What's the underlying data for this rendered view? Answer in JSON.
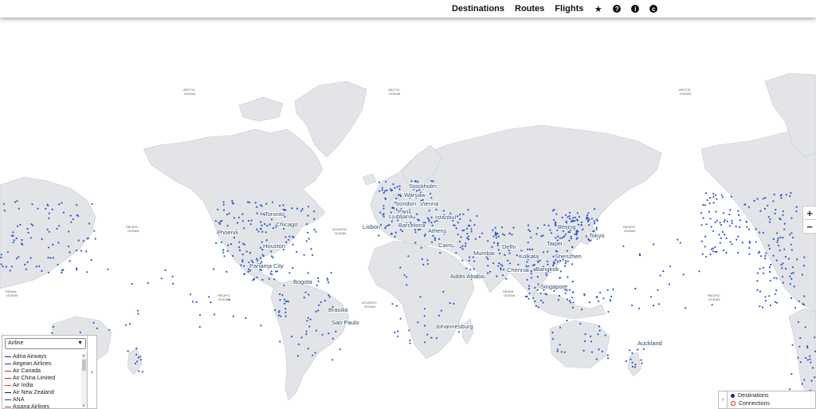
{
  "nav": {
    "links": [
      "Destinations",
      "Routes",
      "Flights"
    ],
    "icons": [
      "star-icon",
      "question-icon",
      "info-icon",
      "copyright-icon"
    ]
  },
  "map": {
    "ocean_labels": {
      "arctic": "ARCTIC\nOCEAN",
      "pacific": "PACIFIC\nOCEAN",
      "atlantic": "ATLANTIC\nOCEAN",
      "indian": "INDIAN\nOCEAN"
    },
    "cities": [
      "Toronto",
      "Chicago",
      "Phoenix",
      "Houston",
      "Panama City",
      "Bogota",
      "Brasilia",
      "Sao Paulo",
      "Lisbon",
      "Stockholm",
      "Warsaw",
      "London",
      "Paris",
      "Vienna",
      "Ljubljana",
      "Istanbul",
      "Barcelona",
      "Athens",
      "Cairo",
      "Addis Ababa",
      "Johannesburg",
      "Mumbai",
      "Delhi",
      "Kolkata",
      "Chennai",
      "Bangkok",
      "Singapore",
      "Beijing",
      "Taipei",
      "Shenzhen",
      "Tokyo",
      "Auckland"
    ],
    "zoom_in": "+",
    "zoom_out": "−"
  },
  "airline_panel": {
    "select_value": "Airline",
    "items": [
      {
        "name": "Adria Airways",
        "color": "#1e2f78"
      },
      {
        "name": "Aegean Airlines",
        "color": "#1e3f9a"
      },
      {
        "name": "Air Canada",
        "color": "#d01f25"
      },
      {
        "name": "Air China Limited",
        "color": "#d01f25"
      },
      {
        "name": "Air India",
        "color": "#e0302a"
      },
      {
        "name": "Air New Zealand",
        "color": "#1a1a1a"
      },
      {
        "name": "ANA",
        "color": "#1b3f8f"
      },
      {
        "name": "Asiana Airlines",
        "color": "#c41e2a"
      }
    ],
    "collapse_icon": "‹"
  },
  "legend": {
    "toggle": "›",
    "destinations": "Destinations",
    "connections": "Connections"
  },
  "colors": {
    "land": "#e2e4e8",
    "border": "#c6cad0",
    "dot": "#2d57c6"
  }
}
